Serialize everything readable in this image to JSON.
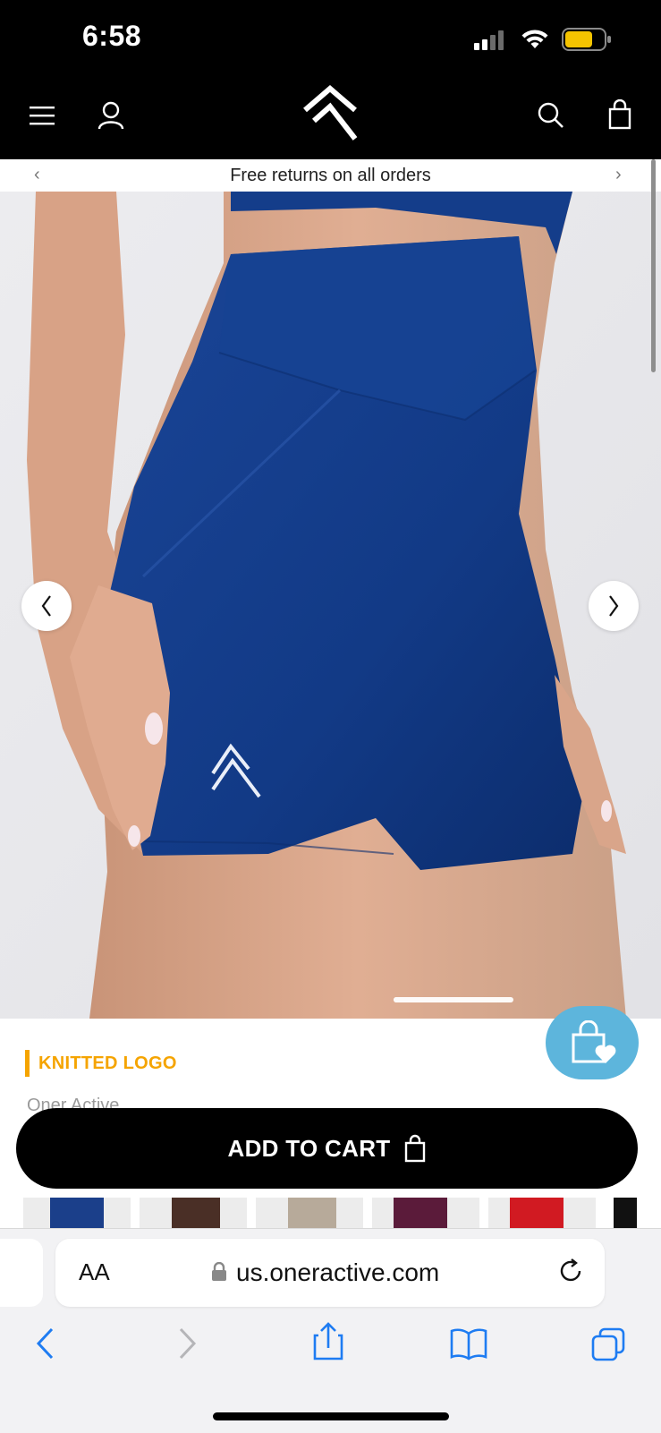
{
  "status_bar": {
    "time": "6:58"
  },
  "header": {
    "icons": [
      "menu-icon",
      "account-icon",
      "brand-logo",
      "search-icon",
      "bag-icon"
    ]
  },
  "announcement": {
    "text": "Free returns on all orders"
  },
  "product": {
    "title": "KNITTED LOGO",
    "brand": "Oner Active",
    "image_position": 0.2
  },
  "cart_button": {
    "label": "ADD TO CART"
  },
  "swatches": [
    "#1b3f8a",
    "#4a2f26",
    "#b7aa9a",
    "#5b1b3a",
    "#d11a22",
    "#111111"
  ],
  "browser": {
    "aa_label": "AA",
    "url": "us.oneractive.com"
  },
  "colors": {
    "accent": "#f5a400",
    "fab": "#5db5dc",
    "shorts": "#123a86"
  }
}
